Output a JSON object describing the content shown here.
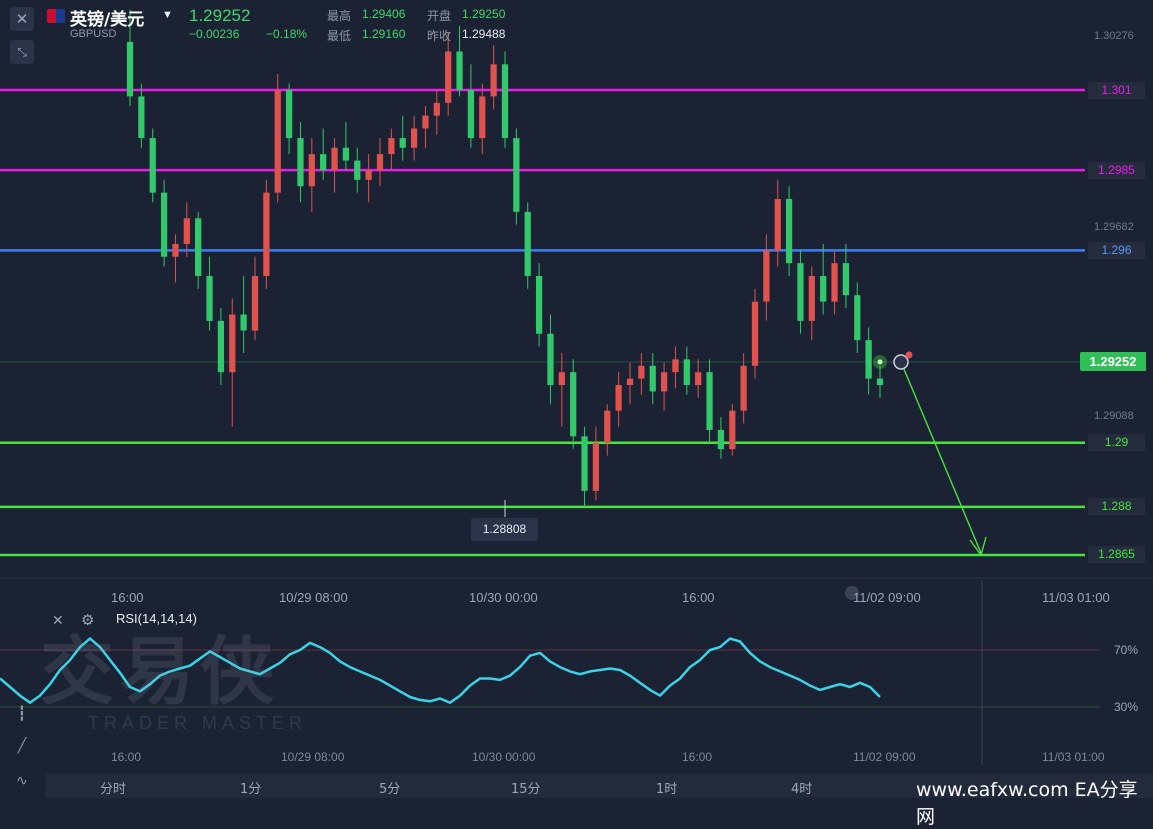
{
  "header": {
    "flag_icon": "uk-us-flag-icon",
    "title": "英镑/美元",
    "dropdown_icon": "caret-down-icon",
    "symbol": "GBPUSD",
    "price": "1.29252",
    "change": "−0.00236",
    "change_pct": "−0.18%",
    "stats": {
      "high_label": "最高",
      "high_value": "1.29406",
      "open_label": "开盘",
      "open_value": "1.29250",
      "low_label": "最低",
      "low_value": "1.29160",
      "prev_label": "昨收",
      "prev_value": "1.29488"
    }
  },
  "price_axis": {
    "labels": [
      "1.30276",
      "1.29682",
      "1.29088"
    ],
    "current_price": "1.29252",
    "low_marker": "1.28808"
  },
  "levels": [
    {
      "label": "1.301",
      "value": 1.301,
      "color": "#e81ee8"
    },
    {
      "label": "1.2985",
      "value": 1.2985,
      "color": "#e81ee8"
    },
    {
      "label": "1.296",
      "value": 1.296,
      "color": "#3d7ef2"
    },
    {
      "label": "1.29",
      "value": 1.29,
      "color": "#49e33e"
    },
    {
      "label": "1.288",
      "value": 1.288,
      "color": "#49e33e"
    },
    {
      "label": "1.2865",
      "value": 1.2865,
      "color": "#49e33e"
    }
  ],
  "time_labels": [
    "16:00",
    "10/29 08:00",
    "10/30 00:00",
    "16:00",
    "11/02 09:00",
    "11/03 01:00"
  ],
  "rsi": {
    "title": "RSI(14,14,14)",
    "levels": [
      "70%",
      "30%"
    ],
    "line_color": "#3ad4e6"
  },
  "timeframes": [
    "分时",
    "1分",
    "5分",
    "15分",
    "1时",
    "4时"
  ],
  "watermark": {
    "cn": "交易侠",
    "en": "TRADER MASTER"
  },
  "site_label": "www.eafxw.com  EA分享网",
  "colors": {
    "up": "#e0524d",
    "down": "#32c96a",
    "background": "#1b2233"
  },
  "chart_data": {
    "type": "candlestick",
    "ylim": [
      1.2856,
      1.3035
    ],
    "candles": [
      [
        1.3025,
        1.3035,
        1.3005,
        1.3008
      ],
      [
        1.3008,
        1.3012,
        1.2992,
        1.2995
      ],
      [
        1.2995,
        1.2998,
        1.2975,
        1.2978
      ],
      [
        1.2978,
        1.2982,
        1.2955,
        1.2958
      ],
      [
        1.2958,
        1.2965,
        1.295,
        1.2962
      ],
      [
        1.2962,
        1.2975,
        1.2958,
        1.297
      ],
      [
        1.297,
        1.2972,
        1.2948,
        1.2952
      ],
      [
        1.2952,
        1.2958,
        1.2935,
        1.2938
      ],
      [
        1.2938,
        1.2942,
        1.2918,
        1.2922
      ],
      [
        1.2922,
        1.2945,
        1.2905,
        1.294
      ],
      [
        1.294,
        1.2952,
        1.2928,
        1.2935
      ],
      [
        1.2935,
        1.2958,
        1.2932,
        1.2952
      ],
      [
        1.2952,
        1.2982,
        1.2948,
        1.2978
      ],
      [
        1.2978,
        1.3015,
        1.2975,
        1.301
      ],
      [
        1.301,
        1.3012,
        1.299,
        1.2995
      ],
      [
        1.2995,
        1.3,
        1.2975,
        1.298
      ],
      [
        1.298,
        1.2995,
        1.2972,
        1.299
      ],
      [
        1.299,
        1.2998,
        1.2982,
        1.2985
      ],
      [
        1.2985,
        1.2995,
        1.2978,
        1.2992
      ],
      [
        1.2992,
        1.3,
        1.2985,
        1.2988
      ],
      [
        1.2988,
        1.2992,
        1.2978,
        1.2982
      ],
      [
        1.2982,
        1.299,
        1.2975,
        1.2985
      ],
      [
        1.2985,
        1.2995,
        1.298,
        1.299
      ],
      [
        1.299,
        1.2998,
        1.2985,
        1.2995
      ],
      [
        1.2995,
        1.3002,
        1.2988,
        1.2992
      ],
      [
        1.2992,
        1.3002,
        1.2988,
        1.2998
      ],
      [
        1.2998,
        1.3005,
        1.2992,
        1.3002
      ],
      [
        1.3002,
        1.301,
        1.2996,
        1.3006
      ],
      [
        1.3006,
        1.3028,
        1.3002,
        1.3022
      ],
      [
        1.3022,
        1.303,
        1.3008,
        1.301
      ],
      [
        1.301,
        1.3018,
        1.2992,
        1.2995
      ],
      [
        1.2995,
        1.3012,
        1.299,
        1.3008
      ],
      [
        1.3008,
        1.3024,
        1.3004,
        1.3018
      ],
      [
        1.3018,
        1.3022,
        1.2992,
        1.2995
      ],
      [
        1.2995,
        1.2998,
        1.2968,
        1.2972
      ],
      [
        1.2972,
        1.2975,
        1.2948,
        1.2952
      ],
      [
        1.2952,
        1.2956,
        1.293,
        1.2934
      ],
      [
        1.2934,
        1.294,
        1.2912,
        1.2918
      ],
      [
        1.2918,
        1.2928,
        1.2905,
        1.2922
      ],
      [
        1.2922,
        1.2926,
        1.2898,
        1.2902
      ],
      [
        1.2902,
        1.2905,
        1.288,
        1.2885
      ],
      [
        1.2885,
        1.2905,
        1.2882,
        1.29
      ],
      [
        1.29,
        1.2912,
        1.2896,
        1.291
      ],
      [
        1.291,
        1.2922,
        1.2905,
        1.2918
      ],
      [
        1.2918,
        1.2925,
        1.2912,
        1.292
      ],
      [
        1.292,
        1.2928,
        1.2915,
        1.2924
      ],
      [
        1.2924,
        1.2928,
        1.2912,
        1.2916
      ],
      [
        1.2916,
        1.2925,
        1.291,
        1.2922
      ],
      [
        1.2922,
        1.293,
        1.2917,
        1.2926
      ],
      [
        1.2926,
        1.293,
        1.2915,
        1.2918
      ],
      [
        1.2918,
        1.2926,
        1.2914,
        1.2922
      ],
      [
        1.2922,
        1.2926,
        1.29,
        1.2904
      ],
      [
        1.2904,
        1.2908,
        1.2895,
        1.2898
      ],
      [
        1.2898,
        1.2912,
        1.2896,
        1.291
      ],
      [
        1.291,
        1.2928,
        1.2906,
        1.2924
      ],
      [
        1.2924,
        1.2948,
        1.292,
        1.2944
      ],
      [
        1.2944,
        1.2965,
        1.2938,
        1.296
      ],
      [
        1.296,
        1.2982,
        1.2955,
        1.2976
      ],
      [
        1.2976,
        1.298,
        1.2952,
        1.2956
      ],
      [
        1.2956,
        1.296,
        1.2934,
        1.2938
      ],
      [
        1.2938,
        1.2955,
        1.2932,
        1.2952
      ],
      [
        1.2952,
        1.2962,
        1.294,
        1.2944
      ],
      [
        1.2944,
        1.296,
        1.294,
        1.2956
      ],
      [
        1.2956,
        1.2962,
        1.2942,
        1.2946
      ],
      [
        1.2946,
        1.295,
        1.2928,
        1.2932
      ],
      [
        1.2932,
        1.2936,
        1.2915,
        1.292
      ],
      [
        1.292,
        1.2924,
        1.2914,
        1.2918
      ]
    ],
    "rsi_values": [
      50,
      44,
      38,
      33,
      38,
      46,
      56,
      63,
      72,
      78,
      72,
      63,
      54,
      44,
      41,
      46,
      52,
      55,
      57,
      59,
      64,
      69,
      65,
      61,
      57,
      55,
      53,
      57,
      61,
      67,
      70,
      75,
      72,
      68,
      62,
      58,
      55,
      52,
      49,
      45,
      41,
      37,
      35,
      34,
      36,
      33,
      38,
      45,
      50,
      50,
      49,
      52,
      58,
      66,
      68,
      62,
      58,
      55,
      53,
      55,
      56,
      57,
      56,
      52,
      47,
      42,
      38,
      45,
      50,
      58,
      63,
      70,
      72,
      78,
      76,
      68,
      62,
      58,
      55,
      52,
      49,
      45,
      42,
      44,
      46,
      44,
      47,
      44,
      37
    ]
  }
}
